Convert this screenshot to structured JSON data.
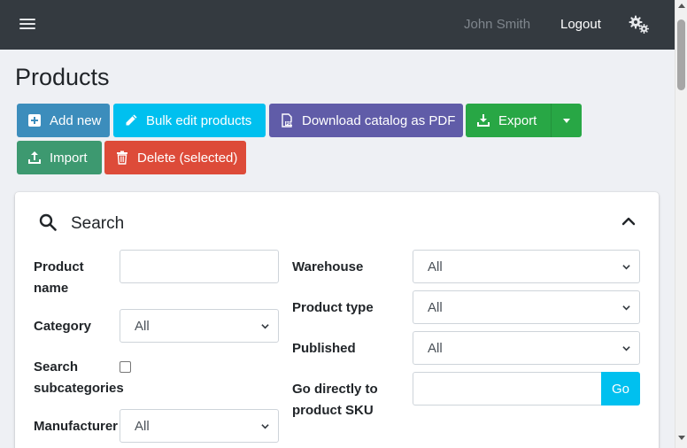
{
  "header": {
    "user_name": "John Smith",
    "logout_label": "Logout",
    "menu_icon": "hamburger-icon",
    "settings_icon": "gears-icon",
    "background": "#343a40"
  },
  "page": {
    "title": "Products"
  },
  "toolbar": {
    "add_new": "Add new",
    "bulk_edit": "Bulk edit products",
    "download_pdf": "Download catalog as PDF",
    "export": "Export",
    "import": "Import",
    "delete_selected": "Delete (selected)",
    "colors": {
      "add_new": "#3c8dbc",
      "bulk_edit": "#00c0ef",
      "download_pdf": "#605ca8",
      "export": "#28a745",
      "import": "#3d9970",
      "delete": "#dd4b39"
    }
  },
  "search": {
    "title": "Search",
    "fields": {
      "product_name": {
        "label_line1": "Product",
        "label_line2": "name",
        "value": ""
      },
      "category": {
        "label": "Category",
        "value": "All"
      },
      "search_subcategories": {
        "label_line1": "Search",
        "label_line2": "subcategories",
        "checked": false
      },
      "manufacturer": {
        "label": "Manufacturer",
        "value": "All"
      },
      "warehouse": {
        "label": "Warehouse",
        "value": "All"
      },
      "product_type": {
        "label": "Product type",
        "value": "All"
      },
      "published": {
        "label": "Published",
        "value": "All"
      },
      "go_to_sku": {
        "label_line1": "Go directly to",
        "label_line2": "product SKU",
        "value": "",
        "button": "Go"
      }
    }
  }
}
